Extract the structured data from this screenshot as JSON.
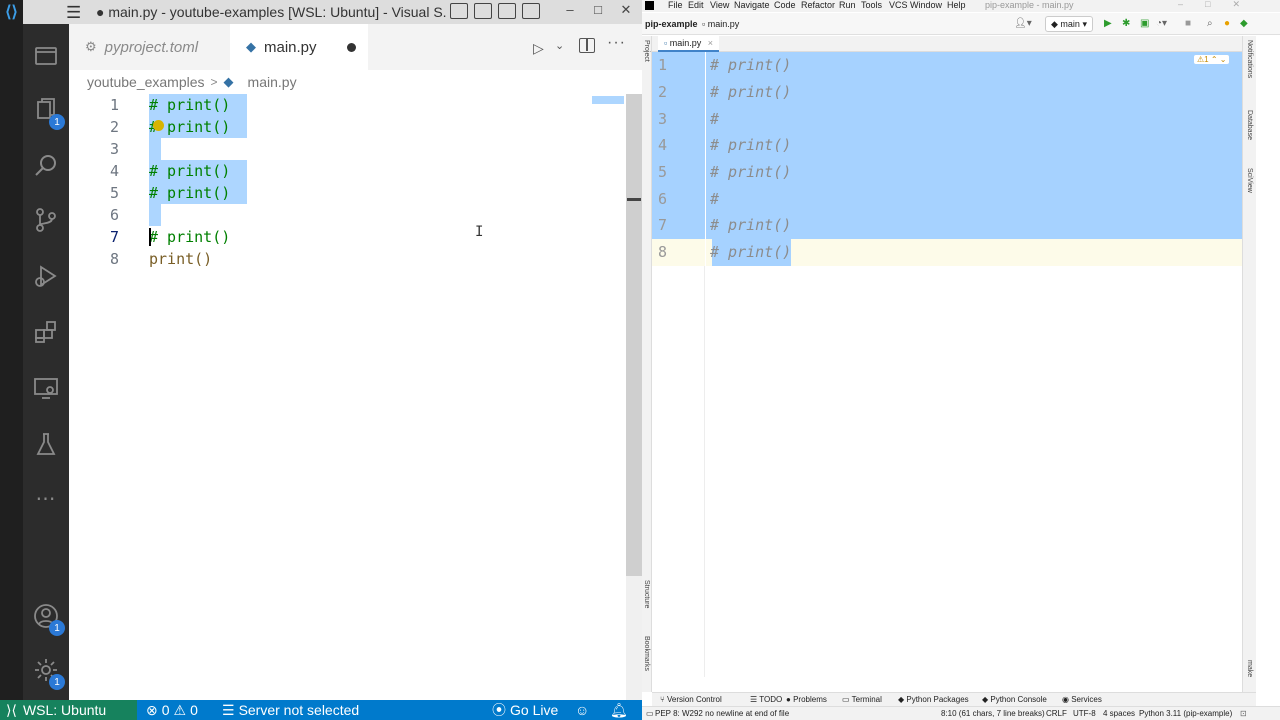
{
  "vscode": {
    "window_title": "● main.py - youtube-examples [WSL: Ubuntu] - Visual S...",
    "win_buttons": [
      "–",
      "□",
      "✕"
    ],
    "activity_badges": {
      "explorer": "1",
      "accounts": "1",
      "manage": "1"
    },
    "tabs": [
      {
        "label": "pyproject.toml",
        "icon": "gear-icon",
        "active": false
      },
      {
        "label": "main.py",
        "icon": "python-icon",
        "active": true,
        "dirty": true
      }
    ],
    "breadcrumb": {
      "folder": "youtube_examples",
      "separator": ">",
      "file": "main.py"
    },
    "editor": {
      "lines": [
        {
          "num": "1",
          "text": "# print()",
          "kind": "comment",
          "selected": true
        },
        {
          "num": "2",
          "text": "# print()",
          "kind": "comment",
          "selected": true
        },
        {
          "num": "3",
          "text": "",
          "kind": "comment",
          "selected": true
        },
        {
          "num": "4",
          "text": "# print()",
          "kind": "comment",
          "selected": true
        },
        {
          "num": "5",
          "text": "# print()",
          "kind": "comment",
          "selected": true
        },
        {
          "num": "6",
          "text": "",
          "kind": "comment",
          "selected": true
        },
        {
          "num": "7",
          "text": "# print()",
          "kind": "comment",
          "selected": false
        },
        {
          "num": "8",
          "text": "print()",
          "kind": "plain",
          "selected": false
        }
      ]
    },
    "status": {
      "remote": "WSL: Ubuntu",
      "errors": "0",
      "warnings": "0",
      "server": "Server not selected",
      "go_live": "Go Live"
    },
    "colors": {
      "status_bg": "#007acc",
      "remote_bg": "#16825d",
      "selection": "#add6ff",
      "comment": "#008000"
    }
  },
  "pycharm": {
    "menu": [
      "File",
      "Edit",
      "View",
      "Navigate",
      "Code",
      "Refactor",
      "Run",
      "Tools",
      "VCS",
      "Window",
      "Help"
    ],
    "window_title": "pip-example - main.py",
    "nav": {
      "project": "pip-example",
      "file": "main.py",
      "branch": "main"
    },
    "tab": {
      "label": "main.py",
      "close": "×"
    },
    "lines": [
      {
        "num": "1",
        "text": "# print()"
      },
      {
        "num": "2",
        "text": "# print()"
      },
      {
        "num": "3",
        "text": "#"
      },
      {
        "num": "4",
        "text": "# print()"
      },
      {
        "num": "5",
        "text": "# print()"
      },
      {
        "num": "6",
        "text": "#"
      },
      {
        "num": "7",
        "text": "# print()"
      },
      {
        "num": "8",
        "text": "# print()"
      }
    ],
    "inspection": "⚠1 ⌃ ⌄",
    "left_labels": [
      "Project",
      "Structure",
      "Bookmarks"
    ],
    "right_labels": [
      "Notifications",
      "Database",
      "SciView",
      "make"
    ],
    "bottom_tools": [
      "Version Control",
      "TODO",
      "Problems",
      "Terminal",
      "Python Packages",
      "Python Console",
      "Services"
    ],
    "status": {
      "message": "PEP 8: W292 no newline at end of file",
      "position": "8:10 (61 chars, 7 line breaks)",
      "line_sep": "CRLF",
      "encoding": "UTF-8",
      "indent": "4 spaces",
      "interpreter": "Python 3.11 (pip-example)"
    },
    "colors": {
      "selection": "#a6d2ff",
      "current_line": "#fdfbe9",
      "comment": "#8c8c8c"
    }
  }
}
